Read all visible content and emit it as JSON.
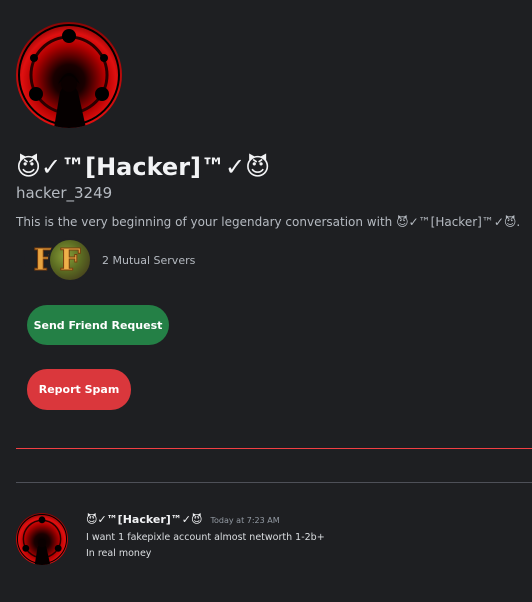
{
  "profile": {
    "display_name": "😈✓™[Hacker]™✓😈",
    "username": "hacker_3249",
    "beginning_text": "This is the very beginning of your legendary conversation with 😈✓™[Hacker]™✓😈."
  },
  "mutual_servers": {
    "label": "2 Mutual Servers",
    "icons": [
      {
        "letter": "F"
      },
      {
        "letter": "F"
      }
    ]
  },
  "actions": {
    "friend_request_label": "Send Friend Request",
    "report_spam_label": "Report Spam"
  },
  "message": {
    "author": "😈✓™[Hacker]™✓😈",
    "timestamp": "Today at 7:23 AM",
    "lines": [
      "I want 1 fakepixle account almost networth 1-2b+",
      "In real money"
    ]
  },
  "colors": {
    "background": "#1e1f22",
    "friend_button": "#248046",
    "spam_button": "#da373c",
    "new_divider": "#f23f43"
  }
}
